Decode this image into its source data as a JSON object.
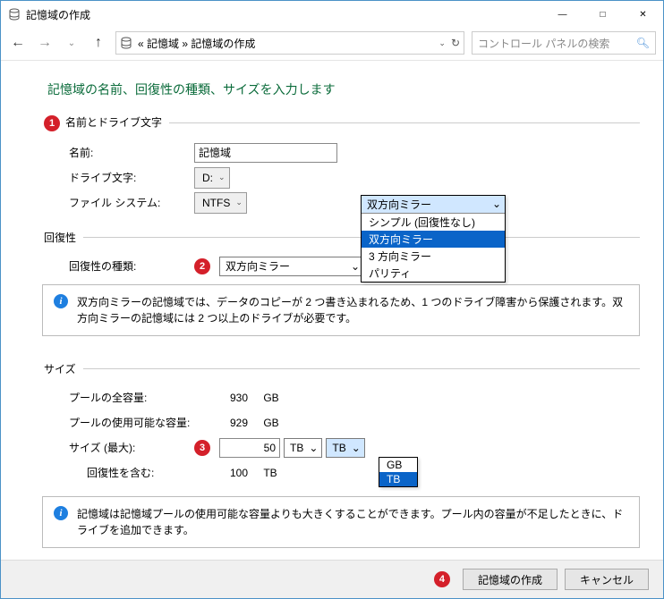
{
  "window": {
    "title": "記憶域の作成"
  },
  "nav": {
    "crumbs": "«  記憶域  »  記憶域の作成",
    "search_placeholder": "コントロール パネルの検索"
  },
  "page_heading": "記憶域の名前、回復性の種類、サイズを入力します",
  "group_name": {
    "legend": "名前とドライブ文字",
    "badge": "1",
    "name_label": "名前:",
    "name_value": "記憶域",
    "drive_label": "ドライブ文字:",
    "drive_value": "D:",
    "fs_label": "ファイル システム:",
    "fs_value": "NTFS"
  },
  "group_resil": {
    "legend": "回復性",
    "type_label": "回復性の種類:",
    "badge": "2",
    "type_value": "双方向ミラー",
    "dropdown": {
      "header": "双方向ミラー",
      "options": [
        {
          "label": "シンプル (回復性なし)",
          "selected": false
        },
        {
          "label": "双方向ミラー",
          "selected": true
        },
        {
          "label": "3 方向ミラー",
          "selected": false
        },
        {
          "label": "パリティ",
          "selected": false
        }
      ]
    },
    "info": "双方向ミラーの記憶域では、データのコピーが 2 つ書き込まれるため、1 つのドライブ障害から保護されます。双方向ミラーの記憶域には 2 つ以上のドライブが必要です。"
  },
  "group_size": {
    "legend": "サイズ",
    "pool_total_label": "プールの全容量:",
    "pool_total_value": "930",
    "pool_total_unit": "GB",
    "pool_avail_label": "プールの使用可能な容量:",
    "pool_avail_value": "929",
    "pool_avail_unit": "GB",
    "size_label": "サイズ (最大):",
    "badge": "3",
    "size_value": "50",
    "size_unit1": "TB",
    "size_unit2": "TB",
    "unit_dropdown": {
      "options": [
        {
          "label": "GB",
          "selected": false
        },
        {
          "label": "TB",
          "selected": true
        }
      ]
    },
    "incl_label": "回復性を含む:",
    "incl_value": "100",
    "incl_unit": "TB",
    "info": "記憶域は記憶域プールの使用可能な容量よりも大きくすることができます。プール内の容量が不足したときに、ドライブを追加できます。"
  },
  "footer": {
    "badge": "4",
    "create": "記憶域の作成",
    "cancel": "キャンセル"
  }
}
